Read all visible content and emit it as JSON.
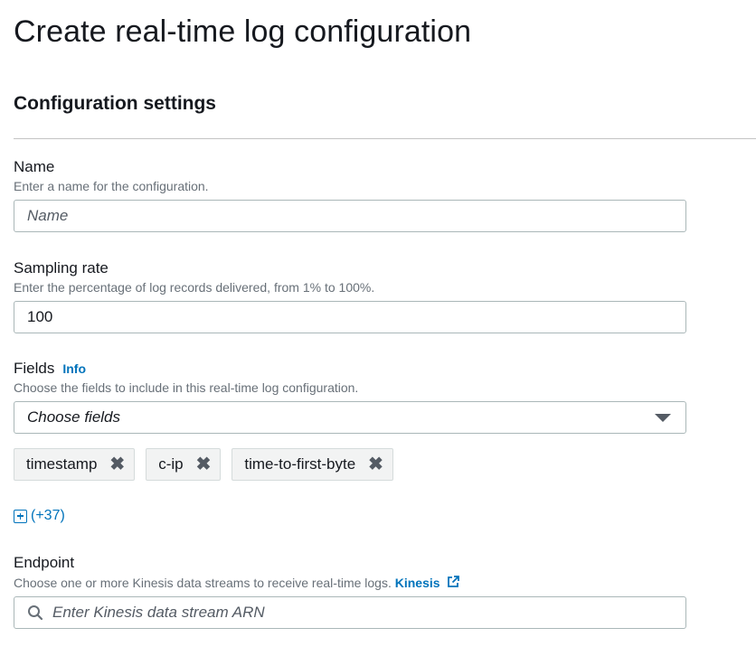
{
  "page": {
    "title": "Create real-time log configuration"
  },
  "section": {
    "title": "Configuration settings"
  },
  "name_field": {
    "label": "Name",
    "description": "Enter a name for the configuration.",
    "placeholder": "Name",
    "value": ""
  },
  "sampling_field": {
    "label": "Sampling rate",
    "description": "Enter the percentage of log records delivered, from 1% to 100%.",
    "value": "100"
  },
  "fields_field": {
    "label": "Fields",
    "info_link": "Info",
    "description": "Choose the fields to include in this real-time log configuration.",
    "select_placeholder": "Choose fields",
    "tokens": [
      "timestamp",
      "c-ip",
      "time-to-first-byte"
    ],
    "more_label": "(+37)"
  },
  "endpoint_field": {
    "label": "Endpoint",
    "description": "Choose one or more Kinesis data streams to receive real-time logs.",
    "link_label": "Kinesis",
    "placeholder": "Enter Kinesis data stream ARN"
  },
  "icons": {
    "remove": "close-icon",
    "dropdown": "caret-down-icon",
    "expand": "plus-square-icon",
    "external": "external-link-icon",
    "search": "search-icon"
  },
  "colors": {
    "link": "#0073bb",
    "text": "#16191f",
    "muted": "#687078",
    "border": "#aab7b8",
    "token_bg": "#f2f3f3"
  }
}
